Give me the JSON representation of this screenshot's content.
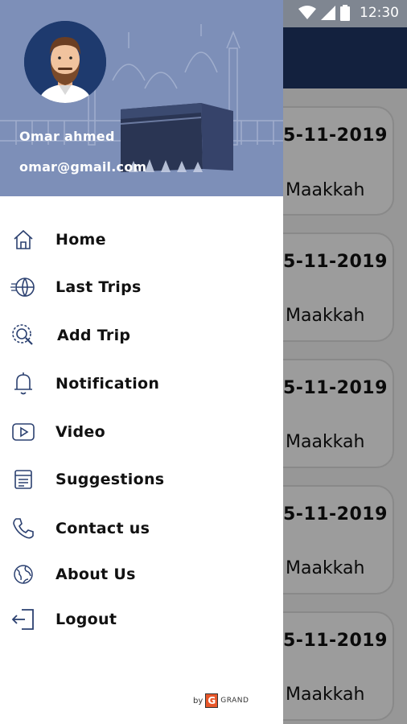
{
  "status_bar": {
    "time": "12:30"
  },
  "background_trips": [
    {
      "date": "5-11-2019",
      "place": "Maakkah"
    },
    {
      "date": "5-11-2019",
      "place": "Maakkah"
    },
    {
      "date": "5-11-2019",
      "place": "Maakkah"
    },
    {
      "date": "5-11-2019",
      "place": "Maakkah"
    },
    {
      "date": "5-11-2019",
      "place": "Maakkah"
    }
  ],
  "drawer": {
    "user": {
      "name": "Omar ahmed",
      "email": "omar@gmail.com"
    },
    "menu": [
      {
        "label": "Home",
        "icon": "home-icon"
      },
      {
        "label": "Last Trips",
        "icon": "globe-speed-icon"
      },
      {
        "label": "Add Trip",
        "icon": "globe-search-icon"
      },
      {
        "label": "Notification",
        "icon": "bell-icon"
      },
      {
        "label": "Video",
        "icon": "play-icon"
      },
      {
        "label": "Suggestions",
        "icon": "note-icon"
      },
      {
        "label": "Contact us",
        "icon": "phone-icon"
      },
      {
        "label": "About Us",
        "icon": "globe-icon"
      },
      {
        "label": "Logout",
        "icon": "logout-icon"
      }
    ],
    "brand": {
      "by": "by",
      "letter": "G",
      "word": "GRAND"
    }
  },
  "colors": {
    "appbar": "#1f3462",
    "header": "#7d8fb8",
    "icon": "#2b4070"
  }
}
